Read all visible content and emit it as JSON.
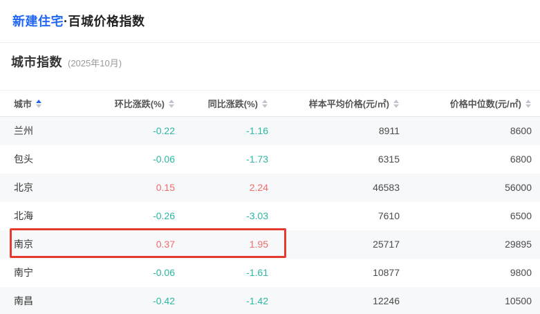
{
  "page_header": {
    "title_highlight": "新建住宅",
    "title_rest": "·百城价格指数"
  },
  "section": {
    "title": "城市指数",
    "period": "(2025年10月)"
  },
  "table": {
    "columns": [
      {
        "label": "城市",
        "sort": "asc"
      },
      {
        "label": "环比涨跌(%)",
        "sort": "none"
      },
      {
        "label": "同比涨跌(%)",
        "sort": "none"
      },
      {
        "label": "样本平均价格(元/㎡)",
        "sort": "none"
      },
      {
        "label": "价格中位数(元/㎡)",
        "sort": "none"
      }
    ],
    "rows": [
      {
        "city": "兰州",
        "mom": "-0.22",
        "yoy": "-1.16",
        "avg_price": "8911",
        "median_price": "8600"
      },
      {
        "city": "包头",
        "mom": "-0.06",
        "yoy": "-1.73",
        "avg_price": "6315",
        "median_price": "6800"
      },
      {
        "city": "北京",
        "mom": "0.15",
        "yoy": "2.24",
        "avg_price": "46583",
        "median_price": "56000"
      },
      {
        "city": "北海",
        "mom": "-0.26",
        "yoy": "-3.03",
        "avg_price": "7610",
        "median_price": "6500"
      },
      {
        "city": "南京",
        "mom": "0.37",
        "yoy": "1.95",
        "avg_price": "25717",
        "median_price": "29895"
      },
      {
        "city": "南宁",
        "mom": "-0.06",
        "yoy": "-1.61",
        "avg_price": "10877",
        "median_price": "9800"
      },
      {
        "city": "南昌",
        "mom": "-0.42",
        "yoy": "-1.42",
        "avg_price": "12246",
        "median_price": "10500"
      }
    ]
  },
  "annotation": {
    "type": "red-highlight-box",
    "target_row": "南京",
    "color": "#e6392f"
  },
  "colors": {
    "accent_blue": "#2166f3",
    "sort_active_blue": "#2468f2",
    "positive_red": "#f06b6b",
    "negative_teal": "#2ab7a3",
    "stripe": "#f7f8fa"
  }
}
